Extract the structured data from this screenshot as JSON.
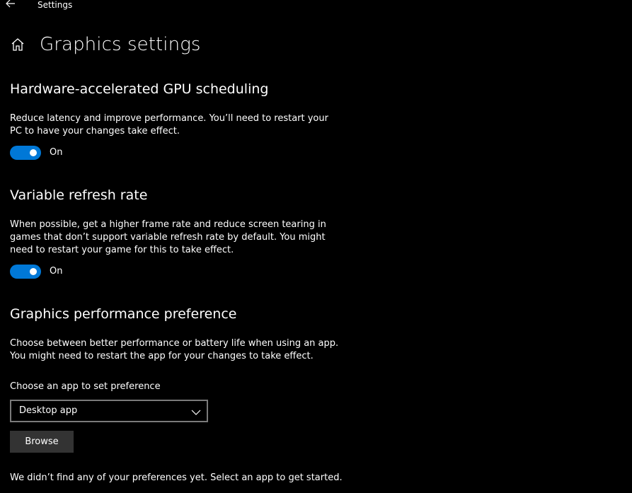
{
  "titlebar": {
    "title": "Settings",
    "back_icon": "arrow-left-icon"
  },
  "header": {
    "title": "Graphics settings",
    "home_icon": "home-icon"
  },
  "gpu_scheduling": {
    "title": "Hardware-accelerated GPU scheduling",
    "description_line1": "Reduce latency and improve performance. You’ll need to restart your",
    "description_line2": "PC to have your changes take effect.",
    "toggle_state": "On",
    "toggle_on": true
  },
  "variable_refresh": {
    "title": "Variable refresh rate",
    "description_line1": "When possible, get a higher frame rate and reduce screen tearing in",
    "description_line2": "games that don’t support variable refresh rate by default. You might",
    "description_line3": "need to restart your game for this to take effect.",
    "toggle_state": "On",
    "toggle_on": true
  },
  "performance_preference": {
    "title": "Graphics performance preference",
    "description_line1": "Choose between better performance or battery life when using an app.",
    "description_line2": "You might need to restart the app for your changes to take effect.",
    "choose_label": "Choose an app to set preference",
    "dropdown_value": "Desktop app",
    "browse_label": "Browse",
    "empty_message": "We didn’t find any of your preferences yet. Select an app to get started."
  },
  "colors": {
    "accent": "#0078d7",
    "background": "#000000",
    "button": "#333333"
  }
}
